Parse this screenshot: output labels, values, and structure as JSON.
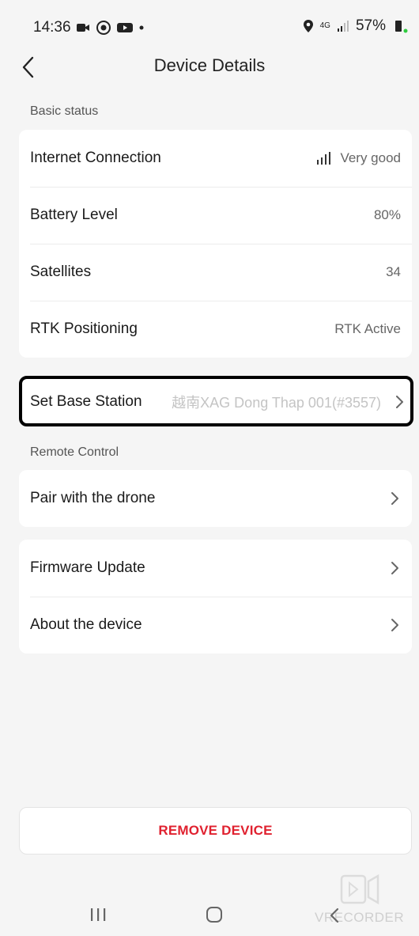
{
  "status_bar": {
    "time": "14:36",
    "network": "4G",
    "battery": "57%"
  },
  "header": {
    "title": "Device Details"
  },
  "basic_status": {
    "section_label": "Basic status",
    "rows": [
      {
        "label": "Internet Connection",
        "value": "Very good"
      },
      {
        "label": "Battery Level",
        "value": "80%"
      },
      {
        "label": "Satellites",
        "value": "34"
      },
      {
        "label": "RTK Positioning",
        "value": "RTK Active"
      }
    ]
  },
  "base_station": {
    "label": "Set Base Station",
    "value": "越南XAG Dong Thap 001(#3557)"
  },
  "remote_control": {
    "section_label": "Remote Control",
    "pair_label": "Pair with the drone"
  },
  "device": {
    "firmware_label": "Firmware Update",
    "about_label": "About the device"
  },
  "remove_button": {
    "label": "REMOVE DEVICE"
  },
  "watermark": {
    "text": "VRECORDER"
  },
  "colors": {
    "accent_red": "#e0212f",
    "background": "#f5f5f5",
    "card": "#ffffff"
  }
}
